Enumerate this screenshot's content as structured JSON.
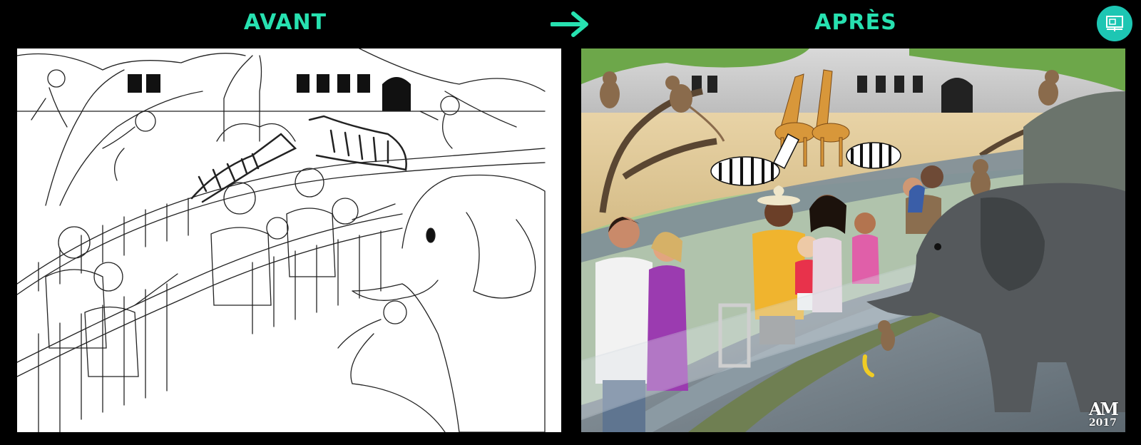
{
  "labels": {
    "before": "AVANT",
    "after": "APRÈS"
  },
  "icons": {
    "arrow": "arrow-right-icon",
    "fullscreen": "fullscreen-presentation-icon"
  },
  "signature": {
    "mark": "AM",
    "year": "2017"
  },
  "colors": {
    "accent": "#27e1b0",
    "button": "#1dc6b3",
    "background": "#000000"
  }
}
